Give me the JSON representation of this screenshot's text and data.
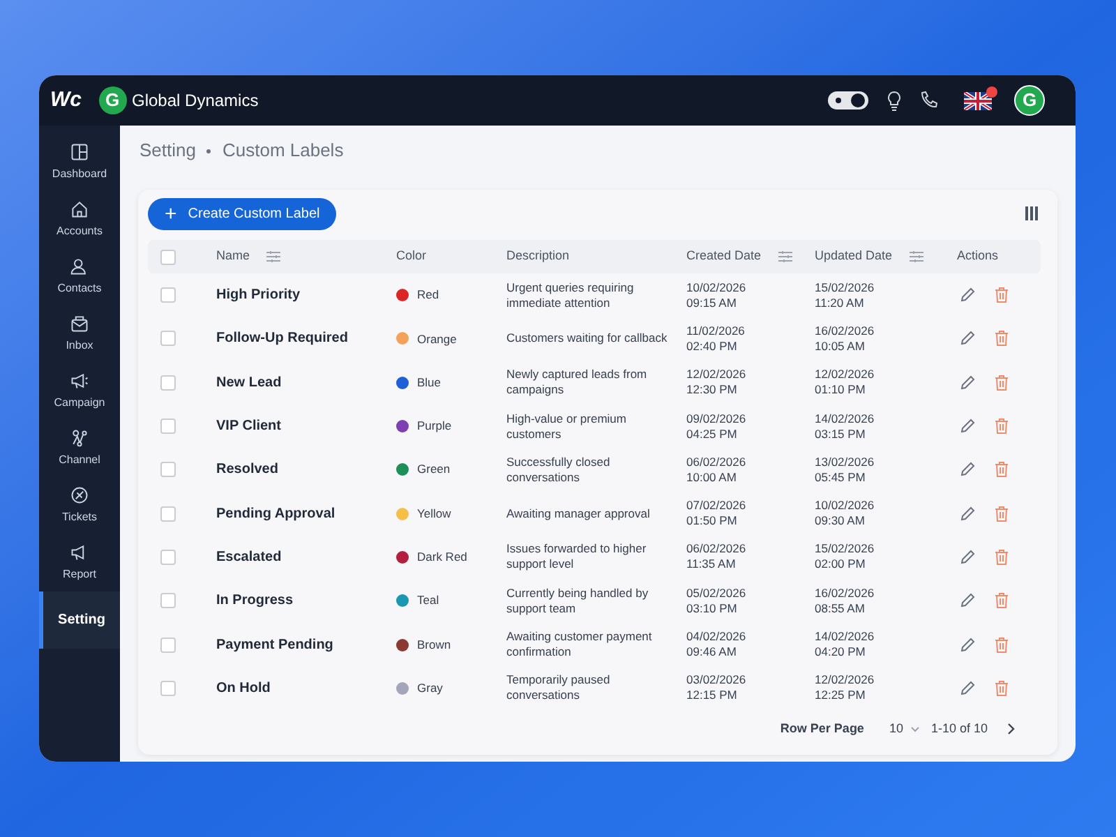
{
  "app": {
    "logo": "Wc",
    "workspace_initial": "G",
    "workspace_name": "Global Dynamics",
    "avatar_initial": "G"
  },
  "sidebar": {
    "items": [
      {
        "label": "Dashboard",
        "selected": false
      },
      {
        "label": "Accounts",
        "selected": false
      },
      {
        "label": "Contacts",
        "selected": false
      },
      {
        "label": "Inbox",
        "selected": false
      },
      {
        "label": "Campaign",
        "selected": false
      },
      {
        "label": "Channel",
        "selected": false
      },
      {
        "label": "Tickets",
        "selected": false
      },
      {
        "label": "Report",
        "selected": false
      },
      {
        "label": "Setting",
        "selected": true
      }
    ]
  },
  "breadcrumb": [
    "Setting",
    "Custom Labels"
  ],
  "create_button": {
    "icon": "+",
    "label": "Create Custom Label"
  },
  "table": {
    "header_checked": false,
    "columns": [
      {
        "label": "Name",
        "filter": true
      },
      {
        "label": "Color",
        "filter": false
      },
      {
        "label": "Description",
        "filter": false
      },
      {
        "label": "Created Date",
        "filter": true
      },
      {
        "label": "Updated Date",
        "filter": true
      },
      {
        "label": "Actions",
        "filter": false
      }
    ],
    "rows": [
      {
        "checked": false,
        "name": "High Priority",
        "color": "#dc2626",
        "color_name": "Red",
        "description": "Urgent queries requiring immediate attention",
        "created": [
          "10/02/2026",
          "09:15 AM"
        ],
        "updated": [
          "15/02/2026",
          "11:20 AM"
        ]
      },
      {
        "checked": false,
        "name": "Follow-Up Required",
        "color": "#f4a259",
        "color_name": "Orange",
        "description": "Customers waiting for callback",
        "created": [
          "11/02/2026",
          "02:40 PM"
        ],
        "updated": [
          "16/02/2026",
          "10:05 AM"
        ]
      },
      {
        "checked": false,
        "name": "New Lead",
        "color": "#1d5fd6",
        "color_name": "Blue",
        "description": "Newly captured leads from campaigns",
        "created": [
          "12/02/2026",
          "12:30 PM"
        ],
        "updated": [
          "12/02/2026",
          "01:10 PM"
        ]
      },
      {
        "checked": false,
        "name": "VIP Client",
        "color": "#7e3fb0",
        "color_name": "Purple",
        "description": "High-value or premium customers",
        "created": [
          "09/02/2026",
          "04:25 PM"
        ],
        "updated": [
          "14/02/2026",
          "03:15 PM"
        ]
      },
      {
        "checked": false,
        "name": "Resolved",
        "color": "#1f8f57",
        "color_name": "Green",
        "description": "Successfully closed conversations",
        "created": [
          "06/02/2026",
          "10:00 AM"
        ],
        "updated": [
          "13/02/2026",
          "05:45 PM"
        ]
      },
      {
        "checked": false,
        "name": "Pending Approval",
        "color": "#f5c04a",
        "color_name": "Yellow",
        "description": "Awaiting manager approval",
        "created": [
          "07/02/2026",
          "01:50 PM"
        ],
        "updated": [
          "10/02/2026",
          "09:30 AM"
        ]
      },
      {
        "checked": false,
        "name": "Escalated",
        "color": "#b3203f",
        "color_name": "Dark Red",
        "description": "Issues forwarded to higher support level",
        "created": [
          "06/02/2026",
          "11:35 AM"
        ],
        "updated": [
          "15/02/2026",
          "02:00 PM"
        ]
      },
      {
        "checked": false,
        "name": "In Progress",
        "color": "#1a98b0",
        "color_name": "Teal",
        "description": "Currently being handled by support team",
        "created": [
          "05/02/2026",
          "03:10 PM"
        ],
        "updated": [
          "16/02/2026",
          "08:55 AM"
        ]
      },
      {
        "checked": false,
        "name": "Payment Pending",
        "color": "#8a3a32",
        "color_name": "Brown",
        "description": "Awaiting customer payment confirmation",
        "created": [
          "04/02/2026",
          "09:46 AM"
        ],
        "updated": [
          "14/02/2026",
          "04:20 PM"
        ]
      },
      {
        "checked": false,
        "name": "On Hold",
        "color": "#a3a6b8",
        "color_name": "Gray",
        "description": "Temporarily paused conversations",
        "created": [
          "03/02/2026",
          "12:15 PM"
        ],
        "updated": [
          "12/02/2026",
          "12:25 PM"
        ]
      }
    ]
  },
  "pagination": {
    "label": "Row Per Page",
    "per_page": "10",
    "range": "1-10 of 10"
  }
}
